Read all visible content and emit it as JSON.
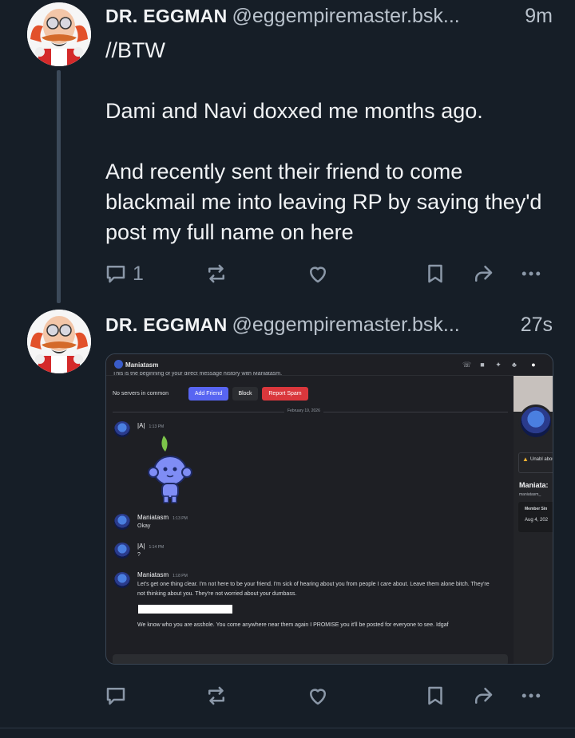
{
  "post1": {
    "display_name": "DR. EGGMAN",
    "handle": "@eggempiremaster.bsk...",
    "time": "9m",
    "text": "//BTW\n\nDami and Navi doxxed me months ago.\n\nAnd recently sent their friend to come blackmail me into leaving RP by saying they'd post my full name on here",
    "reply_count": "1"
  },
  "post2": {
    "display_name": "DR. EGGMAN",
    "handle": "@eggempiremaster.bsk...",
    "time": "27s"
  },
  "embed": {
    "dm_title": "Maniatasm",
    "top_partial": "This is the beginning of your direct message history with Maniatasm.",
    "no_servers": "No servers in common",
    "add_friend": "Add Friend",
    "block": "Block",
    "report_spam": "Report Spam",
    "date_divider": "February 19, 2026",
    "messages": [
      {
        "name": "|A|",
        "time": "1:13 PM",
        "text": ""
      },
      {
        "name": "Maniatasm",
        "time": "1:13 PM",
        "text": "Okay"
      },
      {
        "name": "|A|",
        "time": "1:14 PM",
        "text": "?"
      },
      {
        "name": "Maniatasm",
        "time": "1:18 PM",
        "text": "Let's get one thing clear. I'm not here to be your friend. I'm sick of hearing about you from people I care about. Leave them alone bitch. They're not thinking about you. They're not worried about your dumbass."
      },
      {
        "name": "",
        "time": "",
        "text": "We know who you are asshole. You come anywhere near them again I PROMISE you it'll be posted for everyone to see. Idgaf"
      }
    ],
    "side_warning": "Unabl about",
    "side_name": "Maniata:",
    "side_user": "maniatasm_",
    "side_member_label": "Member Sin",
    "side_member_date": "Aug 4, 202"
  },
  "colors": {
    "background": "#161e27",
    "text": "#f1f3f5",
    "muted": "#8b98a8",
    "add_friend": "#5865f2",
    "report_spam": "#da373c"
  }
}
